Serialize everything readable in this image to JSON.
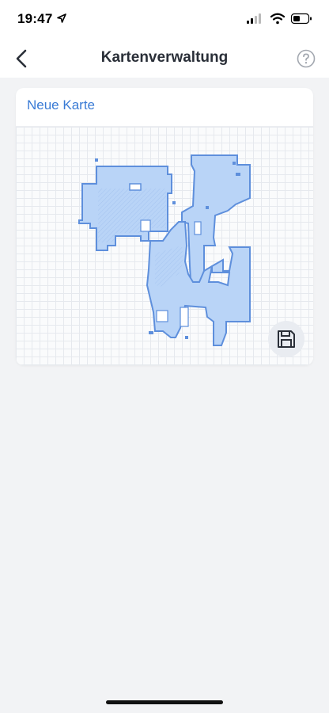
{
  "status_bar": {
    "time": "19:47"
  },
  "nav": {
    "title": "Kartenverwaltung"
  },
  "card": {
    "title": "Neue Karte"
  },
  "icons": {
    "back": "chevron-left-icon",
    "help": "question-circle-icon",
    "save": "floppy-disk-icon",
    "location": "location-arrow-icon",
    "signal": "cellular-signal-icon",
    "wifi": "wifi-icon",
    "battery": "battery-icon"
  },
  "colors": {
    "accent": "#3a7bd5",
    "map_fill": "#b9d4f7",
    "map_border": "#5e8fdc"
  }
}
